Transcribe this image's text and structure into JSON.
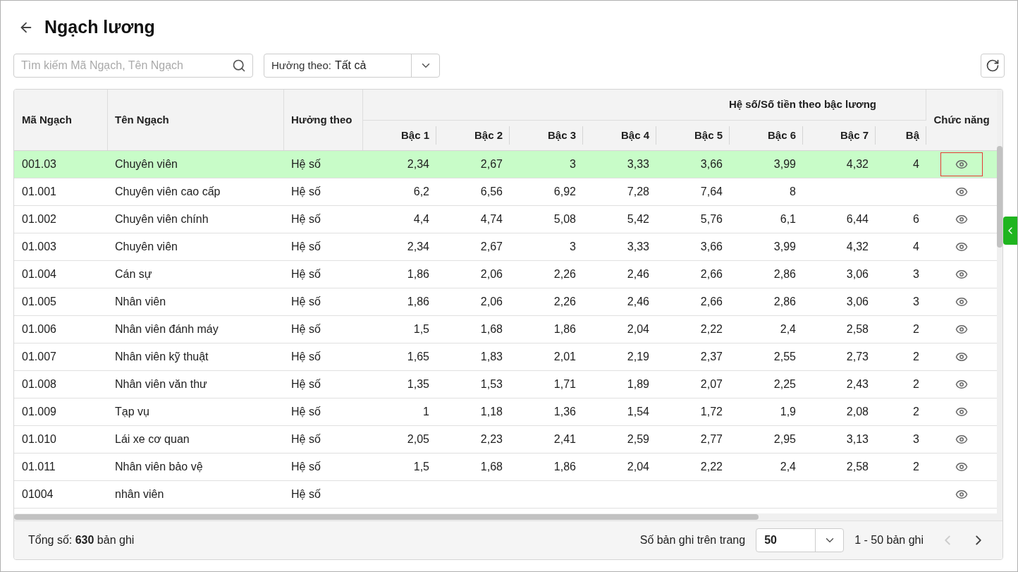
{
  "page": {
    "title": "Ngạch lương"
  },
  "search": {
    "placeholder": "Tìm kiếm Mã Ngạch, Tên Ngạch"
  },
  "filter": {
    "label": "Hưởng theo:",
    "value": "Tất cả"
  },
  "table": {
    "columns": {
      "code": "Mã Ngạch",
      "name": "Tên Ngạch",
      "basis": "Hưởng theo",
      "group": "Hệ số/Số tiền theo bậc lương",
      "levels": [
        "Bậc 1",
        "Bậc 2",
        "Bậc 3",
        "Bậc 4",
        "Bậc 5",
        "Bậc 6",
        "Bậc 7",
        "Bậ"
      ],
      "actions": "Chức năng"
    },
    "rows": [
      {
        "code": "001.03",
        "name": "Chuyên viên",
        "basis": "Hệ số",
        "values": [
          "2,34",
          "2,67",
          "3",
          "3,33",
          "3,66",
          "3,99",
          "4,32",
          "4"
        ],
        "selected": true,
        "focused": true
      },
      {
        "code": "01.001",
        "name": "Chuyên viên cao cấp",
        "basis": "Hệ số",
        "values": [
          "6,2",
          "6,56",
          "6,92",
          "7,28",
          "7,64",
          "8"
        ],
        "selected": false,
        "focused": false
      },
      {
        "code": "01.002",
        "name": "Chuyên viên chính",
        "basis": "Hệ số",
        "values": [
          "4,4",
          "4,74",
          "5,08",
          "5,42",
          "5,76",
          "6,1",
          "6,44",
          "6"
        ],
        "selected": false,
        "focused": false
      },
      {
        "code": "01.003",
        "name": "Chuyên viên",
        "basis": "Hệ số",
        "values": [
          "2,34",
          "2,67",
          "3",
          "3,33",
          "3,66",
          "3,99",
          "4,32",
          "4"
        ],
        "selected": false,
        "focused": false
      },
      {
        "code": "01.004",
        "name": "Cán sự",
        "basis": "Hệ số",
        "values": [
          "1,86",
          "2,06",
          "2,26",
          "2,46",
          "2,66",
          "2,86",
          "3,06",
          "3"
        ],
        "selected": false,
        "focused": false
      },
      {
        "code": "01.005",
        "name": "Nhân viên",
        "basis": "Hệ số",
        "values": [
          "1,86",
          "2,06",
          "2,26",
          "2,46",
          "2,66",
          "2,86",
          "3,06",
          "3"
        ],
        "selected": false,
        "focused": false
      },
      {
        "code": "01.006",
        "name": "Nhân viên đánh máy",
        "basis": "Hệ số",
        "values": [
          "1,5",
          "1,68",
          "1,86",
          "2,04",
          "2,22",
          "2,4",
          "2,58",
          "2"
        ],
        "selected": false,
        "focused": false
      },
      {
        "code": "01.007",
        "name": "Nhân viên kỹ thuật",
        "basis": "Hệ số",
        "values": [
          "1,65",
          "1,83",
          "2,01",
          "2,19",
          "2,37",
          "2,55",
          "2,73",
          "2"
        ],
        "selected": false,
        "focused": false
      },
      {
        "code": "01.008",
        "name": "Nhân viên văn thư",
        "basis": "Hệ số",
        "values": [
          "1,35",
          "1,53",
          "1,71",
          "1,89",
          "2,07",
          "2,25",
          "2,43",
          "2"
        ],
        "selected": false,
        "focused": false
      },
      {
        "code": "01.009",
        "name": "Tạp vụ",
        "basis": "Hệ số",
        "values": [
          "1",
          "1,18",
          "1,36",
          "1,54",
          "1,72",
          "1,9",
          "2,08",
          "2"
        ],
        "selected": false,
        "focused": false
      },
      {
        "code": "01.010",
        "name": "Lái xe cơ quan",
        "basis": "Hệ số",
        "values": [
          "2,05",
          "2,23",
          "2,41",
          "2,59",
          "2,77",
          "2,95",
          "3,13",
          "3"
        ],
        "selected": false,
        "focused": false
      },
      {
        "code": "01.011",
        "name": "Nhân viên bảo vệ",
        "basis": "Hệ số",
        "values": [
          "1,5",
          "1,68",
          "1,86",
          "2,04",
          "2,22",
          "2,4",
          "2,58",
          "2"
        ],
        "selected": false,
        "focused": false
      },
      {
        "code": "01004",
        "name": "nhân viên",
        "basis": "Hệ số",
        "selected": false,
        "focused": false
      }
    ]
  },
  "footer": {
    "total": "Tổng số: **630** bản ghi",
    "page_size_label": "Số bản ghi trên trang",
    "page_size": "50",
    "range": "1 - 50 bản ghi",
    "prev_disabled": true,
    "next_disabled": false
  }
}
